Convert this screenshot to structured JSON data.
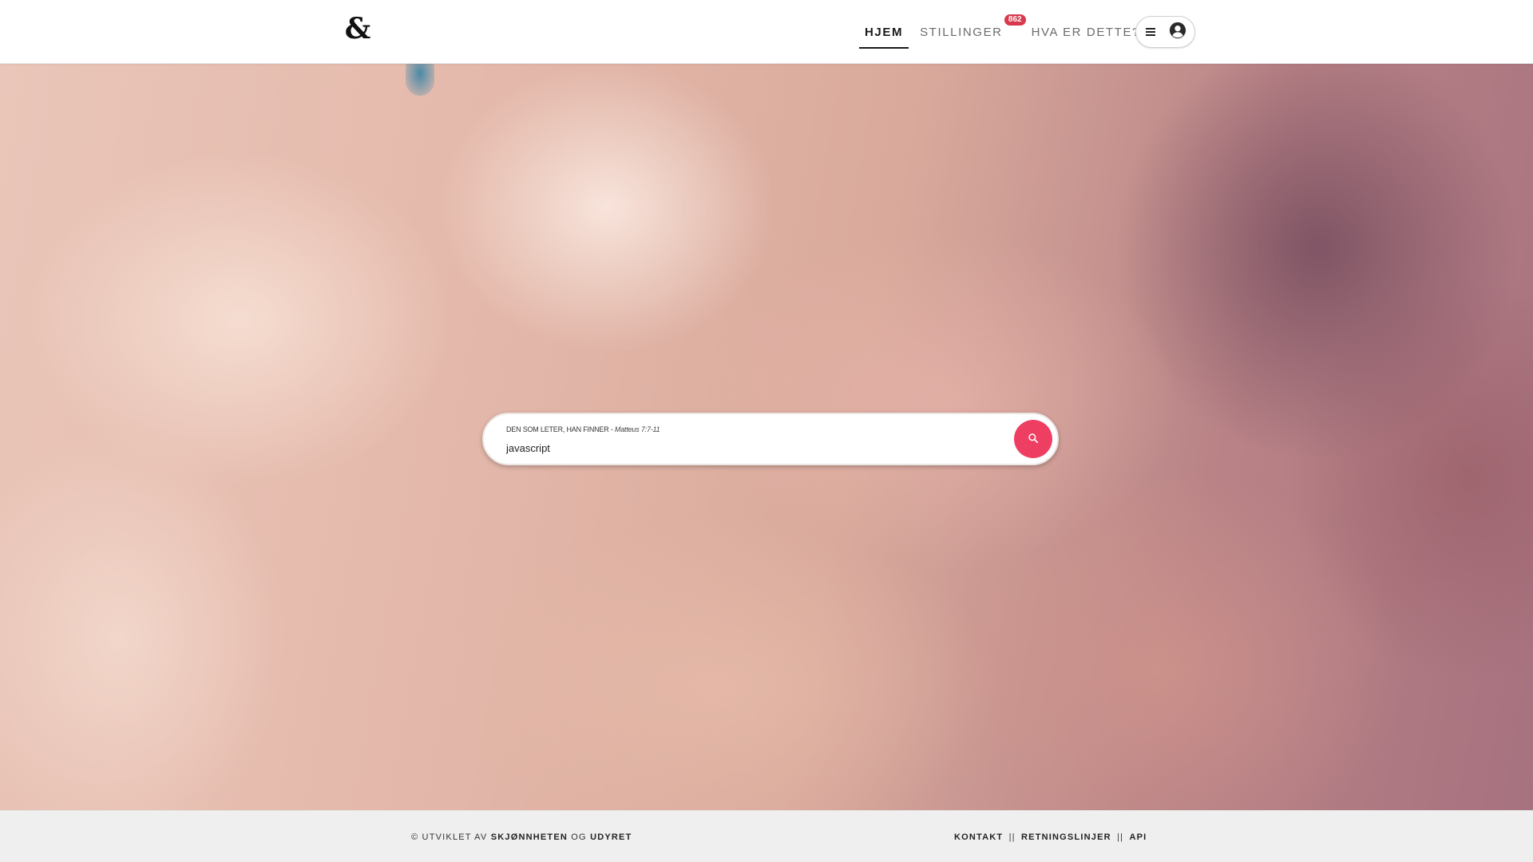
{
  "header": {
    "logo": "&",
    "nav": [
      {
        "label": "HJEM",
        "active": true
      },
      {
        "label": "STILLINGER",
        "badge": "862"
      },
      {
        "label": "HVA ER DETTE?"
      }
    ],
    "icons": {
      "menu": "menu-icon",
      "user": "user-circle-icon"
    }
  },
  "search": {
    "label_text": "DEN SOM LETER, HAN FINNER - ",
    "label_quote": "Matteus 7:7-11",
    "value": "javascript",
    "button_icon": "search-icon",
    "button_color": "#ee3f63"
  },
  "footer": {
    "prefix": "© UTVIKLET AV ",
    "link1": "SKJØNNHETEN",
    "mid": " OG ",
    "link2": "UDYRET",
    "right_links": [
      "KONTAKT",
      "RETNINGSLINJER",
      "API"
    ],
    "separator": "||"
  },
  "colors": {
    "accent": "#ee3f63",
    "badge": "#d63a4c"
  }
}
